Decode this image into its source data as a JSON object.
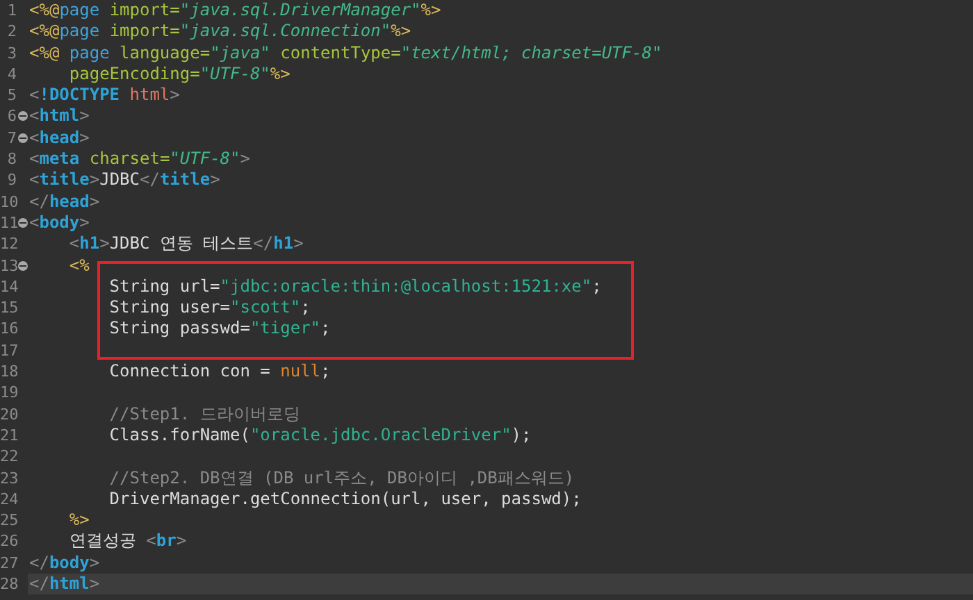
{
  "editor": {
    "lines": [
      {
        "number": "1",
        "tokens": [
          {
            "kind": "jsp",
            "text": "<%@"
          },
          {
            "kind": "directive",
            "text": "page"
          },
          {
            "kind": "attr",
            "text": " import="
          },
          {
            "kind": "value",
            "text": "\"java.sql.DriverManager\""
          },
          {
            "kind": "jsp",
            "text": "%>"
          }
        ]
      },
      {
        "number": "2",
        "tokens": [
          {
            "kind": "jsp",
            "text": "<%@"
          },
          {
            "kind": "directive",
            "text": "page"
          },
          {
            "kind": "attr",
            "text": " import="
          },
          {
            "kind": "value",
            "text": "\"java.sql.Connection\""
          },
          {
            "kind": "jsp",
            "text": "%>"
          }
        ]
      },
      {
        "number": "3",
        "tokens": [
          {
            "kind": "jsp",
            "text": "<%@"
          },
          {
            "kind": "directive",
            "text": " page"
          },
          {
            "kind": "attr",
            "text": " language="
          },
          {
            "kind": "value",
            "text": "\"java\""
          },
          {
            "kind": "attr",
            "text": " contentType="
          },
          {
            "kind": "value",
            "text": "\"text/html; charset=UTF-8\""
          }
        ]
      },
      {
        "number": "4",
        "tokens": [
          {
            "kind": "attr",
            "text": "    pageEncoding="
          },
          {
            "kind": "value",
            "text": "\"UTF-8\""
          },
          {
            "kind": "jsp",
            "text": "%>"
          }
        ]
      },
      {
        "number": "5",
        "tokens": [
          {
            "kind": "bracket",
            "text": "<"
          },
          {
            "kind": "doctype",
            "text": "!DOCTYPE"
          },
          {
            "kind": "doctype-name",
            "text": " html"
          },
          {
            "kind": "bracket",
            "text": ">"
          }
        ]
      },
      {
        "number": "6",
        "fold": true,
        "tokens": [
          {
            "kind": "bracket",
            "text": "<"
          },
          {
            "kind": "tag",
            "text": "html"
          },
          {
            "kind": "bracket",
            "text": ">"
          }
        ]
      },
      {
        "number": "7",
        "fold": true,
        "tokens": [
          {
            "kind": "bracket",
            "text": "<"
          },
          {
            "kind": "tag",
            "text": "head"
          },
          {
            "kind": "bracket",
            "text": ">"
          }
        ]
      },
      {
        "number": "8",
        "tokens": [
          {
            "kind": "bracket",
            "text": "<"
          },
          {
            "kind": "tag",
            "text": "meta"
          },
          {
            "kind": "attr",
            "text": " charset="
          },
          {
            "kind": "value",
            "text": "\"UTF-8\""
          },
          {
            "kind": "bracket",
            "text": ">"
          }
        ]
      },
      {
        "number": "9",
        "tokens": [
          {
            "kind": "bracket",
            "text": "<"
          },
          {
            "kind": "tag",
            "text": "title"
          },
          {
            "kind": "bracket",
            "text": ">"
          },
          {
            "kind": "plain",
            "text": "JDBC"
          },
          {
            "kind": "bracket",
            "text": "</"
          },
          {
            "kind": "tag",
            "text": "title"
          },
          {
            "kind": "bracket",
            "text": ">"
          }
        ]
      },
      {
        "number": "10",
        "tokens": [
          {
            "kind": "bracket",
            "text": "</"
          },
          {
            "kind": "tag",
            "text": "head"
          },
          {
            "kind": "bracket",
            "text": ">"
          }
        ]
      },
      {
        "number": "11",
        "fold": true,
        "tokens": [
          {
            "kind": "bracket",
            "text": "<"
          },
          {
            "kind": "tag",
            "text": "body"
          },
          {
            "kind": "bracket",
            "text": ">"
          }
        ]
      },
      {
        "number": "12",
        "tokens": [
          {
            "kind": "bracket",
            "text": "    <"
          },
          {
            "kind": "tag",
            "text": "h1"
          },
          {
            "kind": "bracket",
            "text": ">"
          },
          {
            "kind": "plain",
            "text": "JDBC 연동 테스트"
          },
          {
            "kind": "bracket",
            "text": "</"
          },
          {
            "kind": "tag",
            "text": "h1"
          },
          {
            "kind": "bracket",
            "text": ">"
          }
        ]
      },
      {
        "number": "13",
        "fold": true,
        "tokens": [
          {
            "kind": "jsp",
            "text": "    <%"
          }
        ]
      },
      {
        "number": "14",
        "boxed": true,
        "tokens": [
          {
            "kind": "plain",
            "text": "        String url="
          },
          {
            "kind": "string",
            "text": "\"jdbc:oracle:thin:@localhost:1521:xe\""
          },
          {
            "kind": "plain",
            "text": ";"
          }
        ]
      },
      {
        "number": "15",
        "boxed": true,
        "tokens": [
          {
            "kind": "plain",
            "text": "        String user="
          },
          {
            "kind": "string",
            "text": "\"scott\""
          },
          {
            "kind": "plain",
            "text": ";"
          }
        ]
      },
      {
        "number": "16",
        "boxed": true,
        "tokens": [
          {
            "kind": "plain",
            "text": "        String passwd="
          },
          {
            "kind": "string",
            "text": "\"tiger\""
          },
          {
            "kind": "plain",
            "text": ";"
          }
        ]
      },
      {
        "number": "17"
      },
      {
        "number": "18",
        "tokens": [
          {
            "kind": "plain",
            "text": "        Connection con = "
          },
          {
            "kind": "keyword",
            "text": "null"
          },
          {
            "kind": "plain",
            "text": ";"
          }
        ]
      },
      {
        "number": "19"
      },
      {
        "number": "20",
        "tokens": [
          {
            "kind": "comment",
            "text": "        //Step1. 드라이버로딩"
          }
        ]
      },
      {
        "number": "21",
        "tokens": [
          {
            "kind": "plain",
            "text": "        Class.forName("
          },
          {
            "kind": "string",
            "text": "\"oracle.jdbc.OracleDriver\""
          },
          {
            "kind": "plain",
            "text": ");"
          }
        ]
      },
      {
        "number": "22"
      },
      {
        "number": "23",
        "tokens": [
          {
            "kind": "comment",
            "text": "        //Step2. DB연결 (DB url주소, DB아이디 ,DB패스워드)"
          }
        ]
      },
      {
        "number": "24",
        "tokens": [
          {
            "kind": "plain",
            "text": "        DriverManager.getConnection(url, user, passwd);"
          }
        ]
      },
      {
        "number": "25",
        "tokens": [
          {
            "kind": "jsp",
            "text": "    %>"
          }
        ]
      },
      {
        "number": "26",
        "tokens": [
          {
            "kind": "plain",
            "text": "    연결성공 "
          },
          {
            "kind": "bracket",
            "text": "<"
          },
          {
            "kind": "tag",
            "text": "br"
          },
          {
            "kind": "bracket",
            "text": ">"
          }
        ]
      },
      {
        "number": "27",
        "tokens": [
          {
            "kind": "bracket",
            "text": "</"
          },
          {
            "kind": "tag",
            "text": "body"
          },
          {
            "kind": "bracket",
            "text": ">"
          }
        ]
      },
      {
        "number": "28",
        "current": true,
        "tokens": [
          {
            "kind": "bracket",
            "text": "</"
          },
          {
            "kind": "tag",
            "text": "html"
          },
          {
            "kind": "bracket",
            "text": ">"
          }
        ]
      }
    ]
  }
}
